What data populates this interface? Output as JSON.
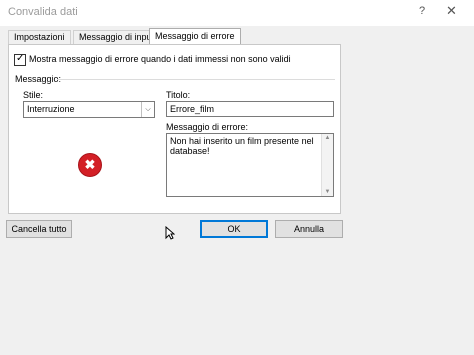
{
  "window": {
    "title": "Convalida dati",
    "help_label": "?",
    "close_label": "✕"
  },
  "tabs": [
    {
      "label": "Impostazioni"
    },
    {
      "label": "Messaggio di input"
    },
    {
      "label": "Messaggio di errore"
    }
  ],
  "active_tab": "Messaggio di errore",
  "error_tab": {
    "show_error_checkbox": {
      "label": "Mostra messaggio di errore quando i dati immessi non sono validi",
      "checked": true,
      "check_glyph": "✓"
    },
    "message_group_label": "Messaggio:",
    "style": {
      "label": "Stile:",
      "value": "Interruzione",
      "arrow": "⌵"
    },
    "title": {
      "label": "Titolo:",
      "value": "Errore_film"
    },
    "error_message": {
      "label": "Messaggio di errore:",
      "value": "Non hai inserito un film presente nel database!"
    },
    "icon": {
      "name": "stop-error-icon",
      "glyph": "✖",
      "color": "#d31f26"
    }
  },
  "buttons": {
    "clear_all": "Cancella tutto",
    "ok": "OK",
    "cancel": "Annulla"
  },
  "colors": {
    "accent": "#0078d7",
    "background": "#f0f0f0"
  }
}
